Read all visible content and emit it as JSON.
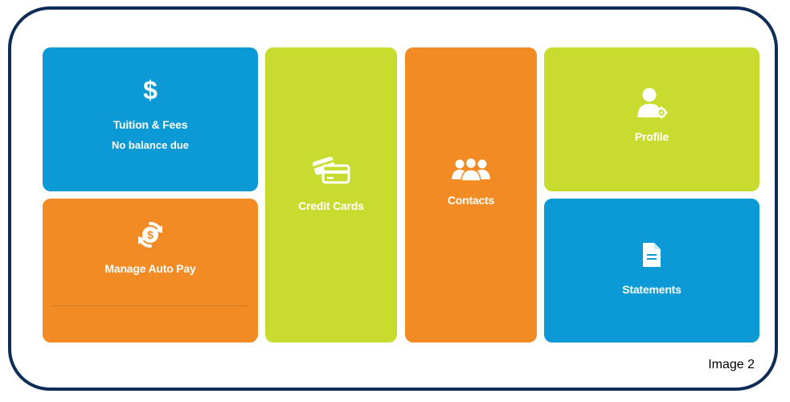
{
  "colors": {
    "border": "#0d2c57",
    "blue": "#0b9ad5",
    "orange": "#f28b23",
    "lime": "#c8dc2f"
  },
  "tiles": {
    "tuition": {
      "label": "Tuition & Fees",
      "sub": "No balance due",
      "icon": "dollar-sign-icon"
    },
    "autopay": {
      "label": "Manage Auto Pay",
      "icon": "auto-pay-icon"
    },
    "credit": {
      "label": "Credit Cards",
      "icon": "credit-cards-icon"
    },
    "contacts": {
      "label": "Contacts",
      "icon": "contacts-group-icon"
    },
    "profile": {
      "label": "Profile",
      "icon": "profile-settings-icon"
    },
    "statements": {
      "label": "Statements",
      "icon": "document-icon"
    }
  },
  "caption": "Image 2"
}
